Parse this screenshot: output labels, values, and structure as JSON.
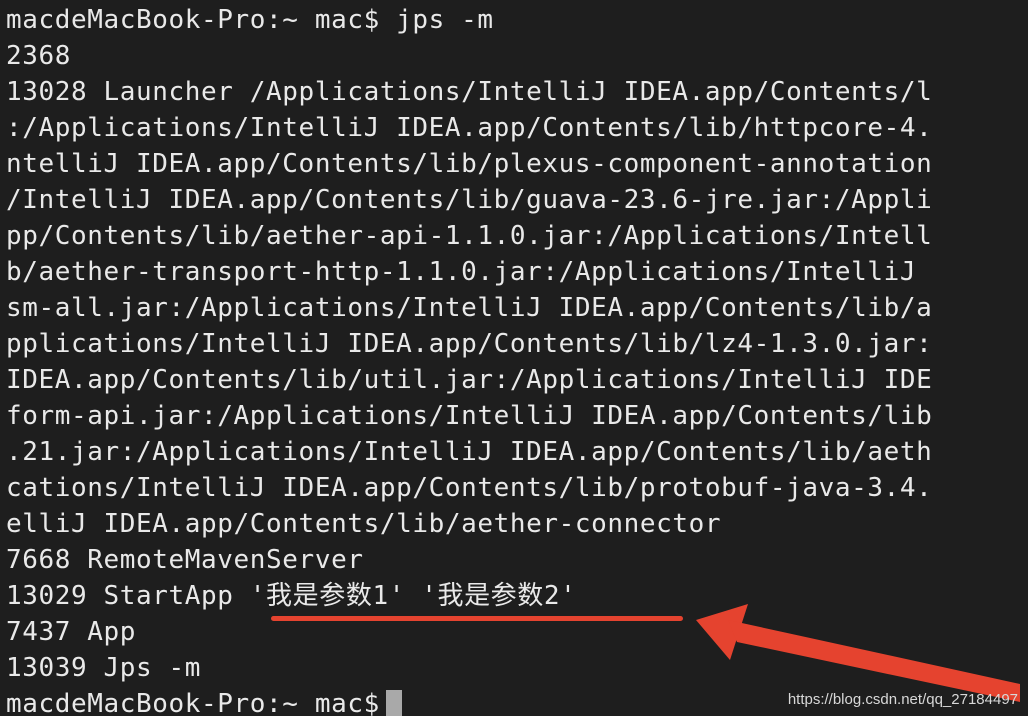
{
  "terminal": {
    "lines": [
      "macdeMacBook-Pro:~ mac$ jps -m",
      "2368",
      "13028 Launcher /Applications/IntelliJ IDEA.app/Contents/l",
      ":/Applications/IntelliJ IDEA.app/Contents/lib/httpcore-4.",
      "ntelliJ IDEA.app/Contents/lib/plexus-component-annotation",
      "/IntelliJ IDEA.app/Contents/lib/guava-23.6-jre.jar:/Appli",
      "pp/Contents/lib/aether-api-1.1.0.jar:/Applications/Intell",
      "b/aether-transport-http-1.1.0.jar:/Applications/IntelliJ ",
      "sm-all.jar:/Applications/IntelliJ IDEA.app/Contents/lib/a",
      "pplications/IntelliJ IDEA.app/Contents/lib/lz4-1.3.0.jar:",
      "IDEA.app/Contents/lib/util.jar:/Applications/IntelliJ IDE",
      "form-api.jar:/Applications/IntelliJ IDEA.app/Contents/lib",
      ".21.jar:/Applications/IntelliJ IDEA.app/Contents/lib/aeth",
      "cations/IntelliJ IDEA.app/Contents/lib/protobuf-java-3.4.",
      "elliJ IDEA.app/Contents/lib/aether-connector",
      "7668 RemoteMavenServer",
      "13029 StartApp '我是参数1' '我是参数2'",
      "7437 App",
      "13039 Jps -m"
    ],
    "prompt": "macdeMacBook-Pro:~ mac$"
  },
  "annotation": {
    "color": "#e5432f"
  },
  "watermark": "https://blog.csdn.net/qq_27184497"
}
